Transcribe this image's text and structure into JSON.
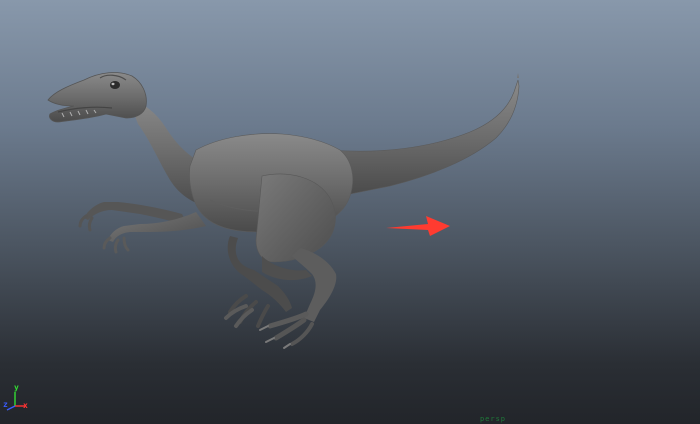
{
  "viewport": {
    "name": "persp",
    "camera_label": "persp",
    "gradient_top": "#8898ab",
    "gradient_bottom": "#22252a"
  },
  "model": {
    "name": "raptor",
    "shading_color": "#6e6e6e"
  },
  "annotation": {
    "arrow_color": "#ff3b30",
    "direction": "right"
  },
  "axis_gizmo": {
    "x_label": "x",
    "y_label": "y",
    "z_label": "z",
    "x_color": "#ff3333",
    "y_color": "#33dd33",
    "z_color": "#3a5cff"
  }
}
